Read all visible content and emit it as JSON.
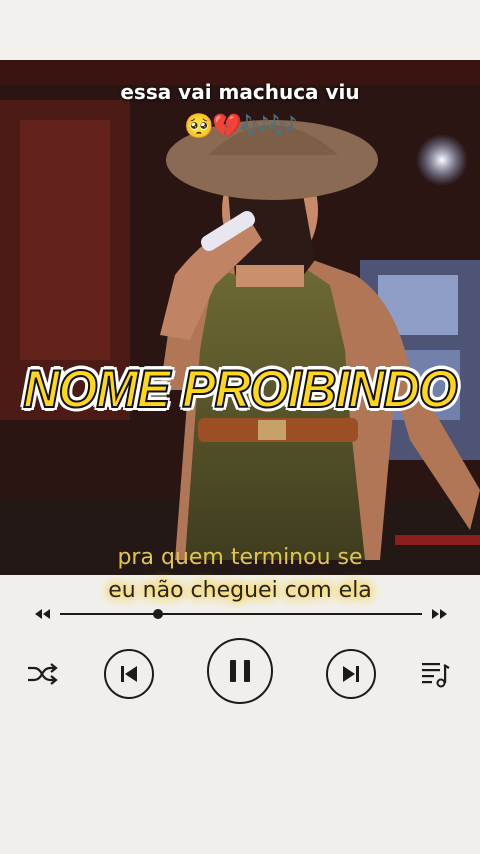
{
  "video": {
    "caption_top": "essa vai machuca viu",
    "caption_emoji": "🥺💔🎶🎶",
    "title": "NOME PROIBINDO",
    "lyrics": {
      "line1": "pra quem terminou se",
      "line2": "eu não cheguei com ela"
    }
  },
  "player": {
    "state": "playing",
    "progress_fraction": 0.27
  },
  "colors": {
    "title_yellow": "#ffd61a",
    "lyric_gold": "#e2c64a",
    "glow": "#ffd84c",
    "icon_dark": "#1b1b1b"
  }
}
